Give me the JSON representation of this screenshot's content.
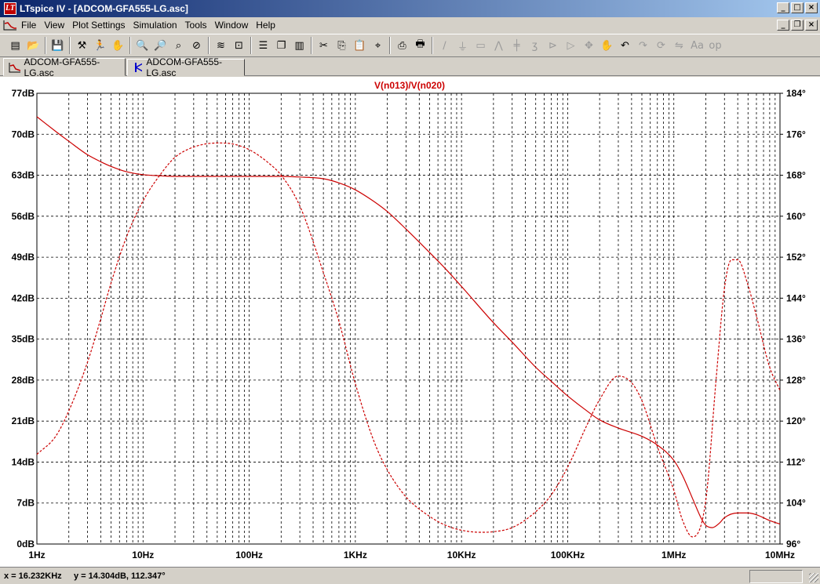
{
  "window": {
    "title": "LTspice IV - [ADCOM-GFA555-LG.asc]",
    "app_icon_glyph": "LT",
    "caption_buttons": [
      "_",
      "□",
      "×"
    ],
    "mdi_buttons": [
      "_",
      "❐",
      "×"
    ]
  },
  "menu": [
    "File",
    "View",
    "Plot Settings",
    "Simulation",
    "Tools",
    "Window",
    "Help"
  ],
  "toolbar": {
    "groups": [
      [
        "new-schematic-icon",
        "open-icon"
      ],
      [
        "save-icon"
      ],
      [
        "control-panel-icon",
        "run-icon",
        "halt-icon"
      ],
      [
        "zoom-in-icon",
        "zoom-out-icon",
        "zoom-fit-icon",
        "zoom-cancel-icon"
      ],
      [
        "autoscale-icon",
        "zoom-extents-icon"
      ],
      [
        "tile-horizontal-icon",
        "cascade-icon",
        "tile-vertical-icon"
      ],
      [
        "cut-icon",
        "copy-icon",
        "paste-icon",
        "find-icon"
      ],
      [
        "print-setup-icon",
        "print-icon"
      ],
      [
        "wire-icon",
        "ground-icon",
        "label-icon",
        "resistor-icon",
        "capacitor-icon",
        "inductor-icon",
        "diode-icon",
        "component-icon",
        "move-icon",
        "drag-icon",
        "undo-icon",
        "redo-icon",
        "rotate-icon",
        "mirror-icon",
        "text-icon",
        "spice-directive-icon"
      ]
    ]
  },
  "tabs": [
    {
      "label": "ADCOM-GFA555-LG.asc",
      "icon": "waveform-icon",
      "active": true
    },
    {
      "label": "ADCOM-GFA555-LG.asc",
      "icon": "schematic-icon",
      "active": false
    }
  ],
  "status": {
    "text": "x = 16.232KHz     y = 14.304dB, 112.347°"
  },
  "colors": {
    "trace": "#cc0000",
    "grid": "#000000",
    "axis_text": "#000000",
    "plot_bg": "#ffffff"
  },
  "chart_data": {
    "type": "line",
    "title": "V(n013)/V(n020)",
    "x_scale": "log",
    "xlim": [
      1,
      10000000
    ],
    "x_ticks": [
      {
        "value": 1,
        "label": "1Hz"
      },
      {
        "value": 10,
        "label": "10Hz"
      },
      {
        "value": 100,
        "label": "100Hz"
      },
      {
        "value": 1000,
        "label": "1KHz"
      },
      {
        "value": 10000,
        "label": "10KHz"
      },
      {
        "value": 100000,
        "label": "100KHz"
      },
      {
        "value": 1000000,
        "label": "1MHz"
      },
      {
        "value": 10000000,
        "label": "10MHz"
      }
    ],
    "y_left": {
      "range": [
        0,
        77
      ],
      "ticks": [
        {
          "value": 0,
          "label": "0dB"
        },
        {
          "value": 7,
          "label": "7dB"
        },
        {
          "value": 14,
          "label": "14dB"
        },
        {
          "value": 21,
          "label": "21dB"
        },
        {
          "value": 28,
          "label": "28dB"
        },
        {
          "value": 35,
          "label": "35dB"
        },
        {
          "value": 42,
          "label": "42dB"
        },
        {
          "value": 49,
          "label": "49dB"
        },
        {
          "value": 56,
          "label": "56dB"
        },
        {
          "value": 63,
          "label": "63dB"
        },
        {
          "value": 70,
          "label": "70dB"
        },
        {
          "value": 77,
          "label": "77dB"
        }
      ]
    },
    "y_right": {
      "range": [
        96,
        184
      ],
      "ticks": [
        {
          "value": 96,
          "label": "96°"
        },
        {
          "value": 104,
          "label": "104°"
        },
        {
          "value": 112,
          "label": "112°"
        },
        {
          "value": 120,
          "label": "120°"
        },
        {
          "value": 128,
          "label": "128°"
        },
        {
          "value": 136,
          "label": "136°"
        },
        {
          "value": 144,
          "label": "144°"
        },
        {
          "value": 152,
          "label": "152°"
        },
        {
          "value": 160,
          "label": "160°"
        },
        {
          "value": 168,
          "label": "168°"
        },
        {
          "value": 176,
          "label": "176°"
        },
        {
          "value": 184,
          "label": "184°"
        }
      ]
    },
    "grid": true,
    "series": [
      {
        "axis": "left",
        "style": "solid",
        "x": [
          1,
          1.5,
          2,
          3,
          4,
          5,
          7,
          10,
          15,
          20,
          30,
          50,
          100,
          200,
          300,
          500,
          700,
          1000,
          1500,
          2000,
          3000,
          5000,
          7000,
          10000,
          20000,
          30000,
          50000,
          70000,
          100000,
          150000,
          200000,
          300000,
          500000,
          700000,
          1000000,
          1200000,
          1500000,
          1800000,
          2000000,
          2300000,
          2700000,
          3000000,
          4000000,
          5000000,
          6000000,
          8000000,
          10000000
        ],
        "values": [
          73,
          70.5,
          68.8,
          66.5,
          65.3,
          64.5,
          63.6,
          63.1,
          62.9,
          62.8,
          62.8,
          62.8,
          62.8,
          62.8,
          62.7,
          62.4,
          61.7,
          60.5,
          58.5,
          56.8,
          53.8,
          49.8,
          47.1,
          44,
          37.8,
          34.5,
          30.2,
          27.8,
          25.3,
          22.8,
          21.2,
          19.8,
          18.4,
          16.9,
          14.3,
          11.8,
          7.8,
          4.5,
          3.2,
          2.8,
          3.6,
          4.5,
          5.3,
          5.3,
          5,
          4,
          3.4
        ]
      },
      {
        "axis": "right",
        "style": "dashed",
        "x": [
          1,
          1.5,
          2,
          3,
          4,
          5,
          7,
          10,
          15,
          20,
          30,
          50,
          70,
          100,
          150,
          200,
          300,
          500,
          700,
          1000,
          1500,
          2000,
          3000,
          5000,
          7000,
          10000,
          15000,
          20000,
          30000,
          50000,
          70000,
          100000,
          150000,
          200000,
          300000,
          400000,
          500000,
          700000,
          1000000,
          1200000,
          1500000,
          2000000,
          2500000,
          3000000,
          3500000,
          4000000,
          5000000,
          6000000,
          8000000,
          10000000
        ],
        "values": [
          113.5,
          117,
          122,
          131.5,
          140,
          147,
          156,
          163,
          168.5,
          171.5,
          173.5,
          174.3,
          174.1,
          173,
          170.5,
          168,
          162,
          149,
          139.5,
          127.3,
          116,
          110.5,
          105.2,
          101.4,
          99.7,
          98.7,
          98.3,
          98.4,
          99.2,
          102.3,
          105.6,
          111,
          119,
          124.2,
          128.8,
          127.5,
          124,
          115,
          106.5,
          100.8,
          97.4,
          104.5,
          128,
          146,
          151.5,
          151.5,
          146.5,
          140.5,
          130.5,
          126
        ]
      }
    ]
  }
}
